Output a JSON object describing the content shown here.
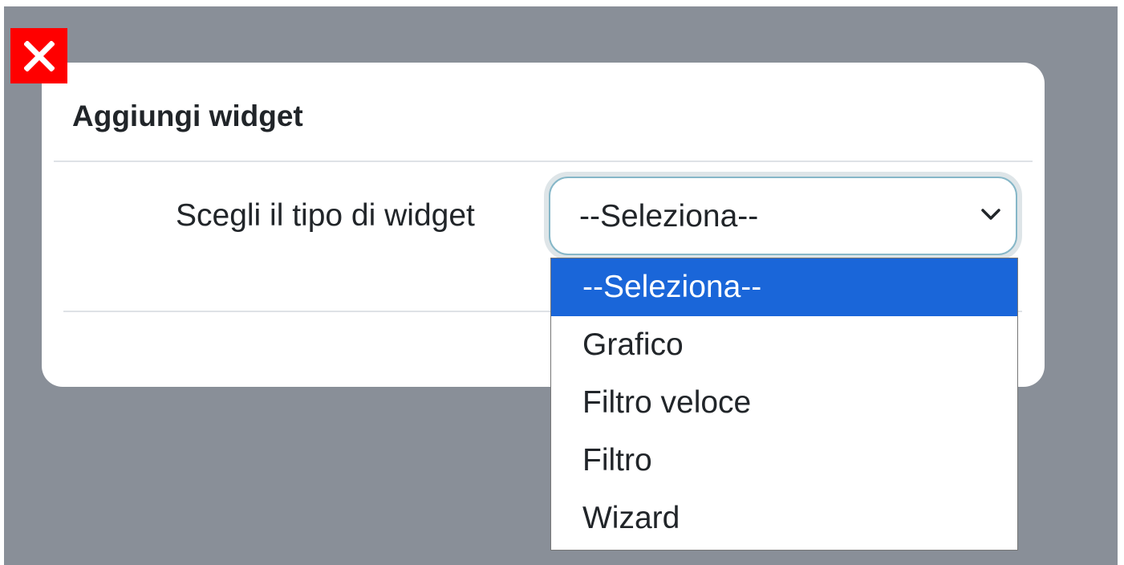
{
  "close_button": {
    "icon": "close-icon",
    "color": "#ff0000"
  },
  "modal": {
    "title": "Aggiungi widget",
    "field_label": "Scegli il tipo di widget",
    "select": {
      "value": "--Seleziona--",
      "icon": "chevron-down-icon"
    }
  },
  "dropdown": {
    "options": [
      {
        "label": "--Seleziona--",
        "selected": true
      },
      {
        "label": "Grafico",
        "selected": false
      },
      {
        "label": "Filtro veloce",
        "selected": false
      },
      {
        "label": "Filtro",
        "selected": false
      },
      {
        "label": "Wizard",
        "selected": false
      }
    ],
    "highlight_color": "#1a66d9"
  }
}
